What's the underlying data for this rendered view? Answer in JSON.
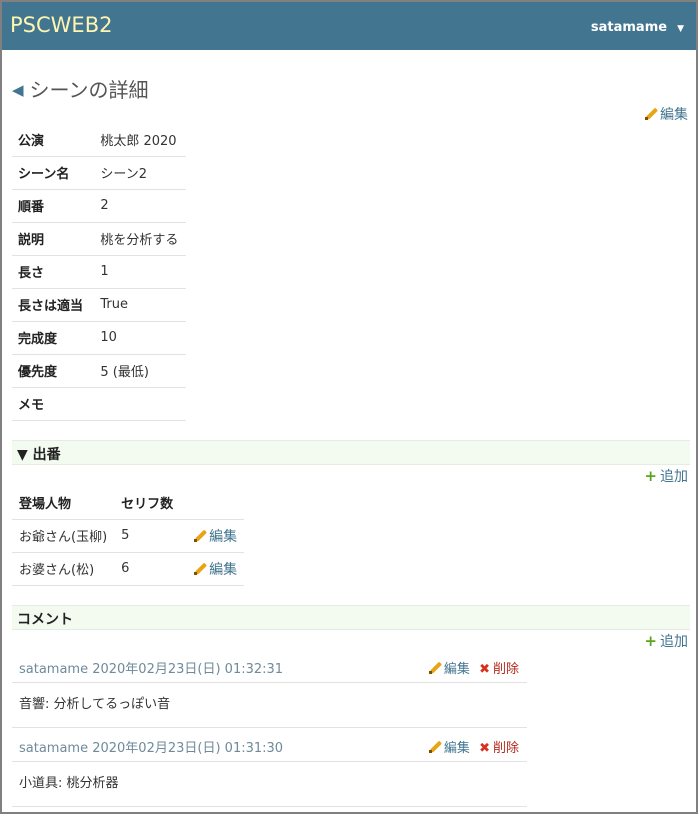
{
  "app": {
    "brand": "PSCWEB2",
    "user": "satamame",
    "user_caret": "▼"
  },
  "page": {
    "back_glyph": "◀",
    "title": "シーンの詳細",
    "edit_label": "編集"
  },
  "detail": [
    {
      "key": "公演",
      "value": "桃太郎 2020"
    },
    {
      "key": "シーン名",
      "value": "シーン2"
    },
    {
      "key": "順番",
      "value": "2"
    },
    {
      "key": "説明",
      "value": "桃を分析する"
    },
    {
      "key": "長さ",
      "value": "1"
    },
    {
      "key": "長さは適当",
      "value": "True"
    },
    {
      "key": "完成度",
      "value": "10"
    },
    {
      "key": "優先度",
      "value": "5 (最低)"
    },
    {
      "key": "メモ",
      "value": ""
    }
  ],
  "appearances": {
    "heading": "▼ 出番",
    "add_label": "追加",
    "columns": [
      "登場人物",
      "セリフ数",
      ""
    ],
    "rows": [
      {
        "character": "お爺さん(玉柳)",
        "lines": "5",
        "edit": "編集"
      },
      {
        "character": "お婆さん(松)",
        "lines": "6",
        "edit": "編集"
      }
    ]
  },
  "comments": {
    "heading": "コメント",
    "add_label": "追加",
    "items": [
      {
        "meta": "satamame 2020年02月23日(日) 01:32:31",
        "edit": "編集",
        "delete": "削除",
        "text": "音響: 分析してるっぽい音"
      },
      {
        "meta": "satamame 2020年02月23日(日) 01:31:30",
        "edit": "編集",
        "delete": "削除",
        "text": "小道具: 桃分析器"
      }
    ]
  },
  "icons": {
    "back": "back-arrow-icon",
    "edit": "pencil-icon",
    "add": "plus-icon",
    "delete": "cross-icon",
    "dropdown": "caret-down-icon"
  },
  "colors": {
    "topbar": "#427590",
    "brand": "#fff5b0",
    "link": "#427590",
    "section_bg": "#f3fbf1",
    "pencil": "#e8a415",
    "plus": "#5aa51e",
    "delete": "#d9301f"
  }
}
